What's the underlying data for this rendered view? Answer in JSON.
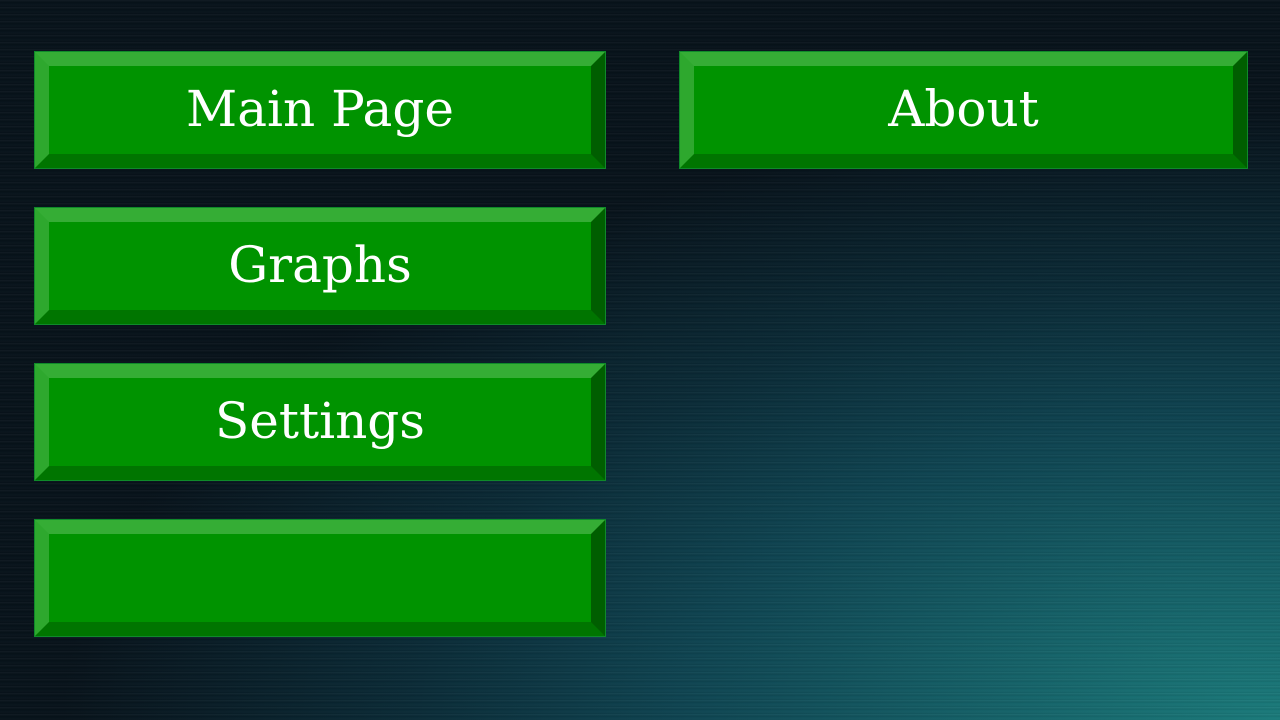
{
  "menu": {
    "main_page_label": "Main Page",
    "about_label": "About",
    "graphs_label": "Graphs",
    "settings_label": "Settings",
    "blank_label": ""
  },
  "colors": {
    "button_face": "#009300",
    "button_highlight": "#35ad35",
    "button_shadow": "#005e00",
    "background_dark": "#07121a",
    "background_teal": "#1a7a7a",
    "label_text": "#ffffff"
  }
}
